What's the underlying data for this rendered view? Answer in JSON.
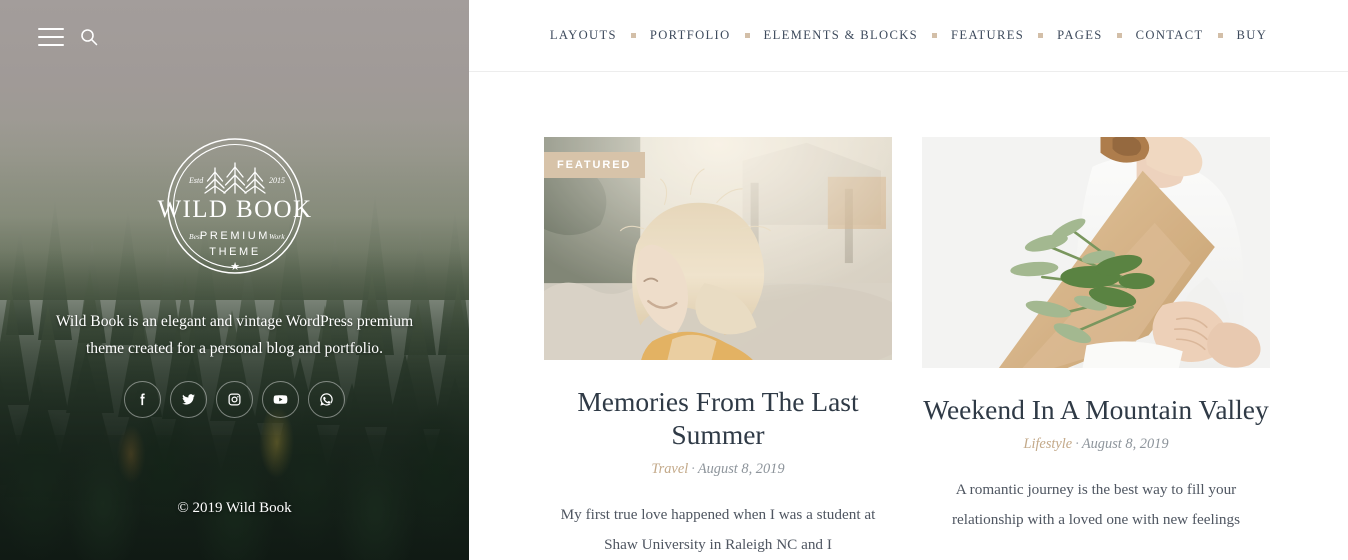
{
  "sidebar": {
    "toolbar": {
      "menu_icon": "hamburger-menu-icon",
      "search_icon": "search-icon"
    },
    "logo": {
      "brand": "WILD BOOK",
      "established_left": "Estd",
      "established_right": "2015",
      "flank_left": "Best",
      "flank_right": "Work",
      "sub_line_1": "PREMIUM",
      "sub_line_2": "THEME",
      "star": "★"
    },
    "tagline": "Wild Book is an elegant and vintage WordPress premium theme created for a personal blog and portfolio.",
    "socials": [
      {
        "name": "facebook",
        "label": "Facebook"
      },
      {
        "name": "twitter",
        "label": "Twitter"
      },
      {
        "name": "instagram",
        "label": "Instagram"
      },
      {
        "name": "youtube",
        "label": "YouTube"
      },
      {
        "name": "whatsapp",
        "label": "WhatsApp"
      }
    ],
    "copyright": "© 2019 Wild Book"
  },
  "nav": {
    "items": [
      {
        "label": "LAYOUTS"
      },
      {
        "label": "PORTFOLIO"
      },
      {
        "label": "ELEMENTS & BLOCKS"
      },
      {
        "label": "FEATURES"
      },
      {
        "label": "PAGES"
      },
      {
        "label": "CONTACT"
      },
      {
        "label": "BUY"
      }
    ]
  },
  "posts": [
    {
      "badge": "FEATURED",
      "has_badge": true,
      "image_alt": "woman-with-blonde-hair-outdoors",
      "title": "Memories From The Last Summer",
      "category": "Travel",
      "separator": "·",
      "date": "August 8, 2019",
      "excerpt": "My first true love happened when I was a student at Shaw University in Raleigh NC and I"
    },
    {
      "badge": "",
      "has_badge": false,
      "image_alt": "woman-holding-fir-bouquet",
      "title": "Weekend In A Mountain Valley",
      "category": "Lifestyle",
      "separator": "·",
      "date": "August 8, 2019",
      "excerpt": "A romantic journey is the best way to fill your relationship with a loved one with new feelings"
    }
  ],
  "colors": {
    "accent_tan": "#d7c3a9",
    "category_tan": "#c3a989",
    "nav_text": "#3d4a5c",
    "title_text": "#2f3a46",
    "meta_text": "#8d949b",
    "body_text": "#4f5661",
    "border": "#ededed"
  }
}
